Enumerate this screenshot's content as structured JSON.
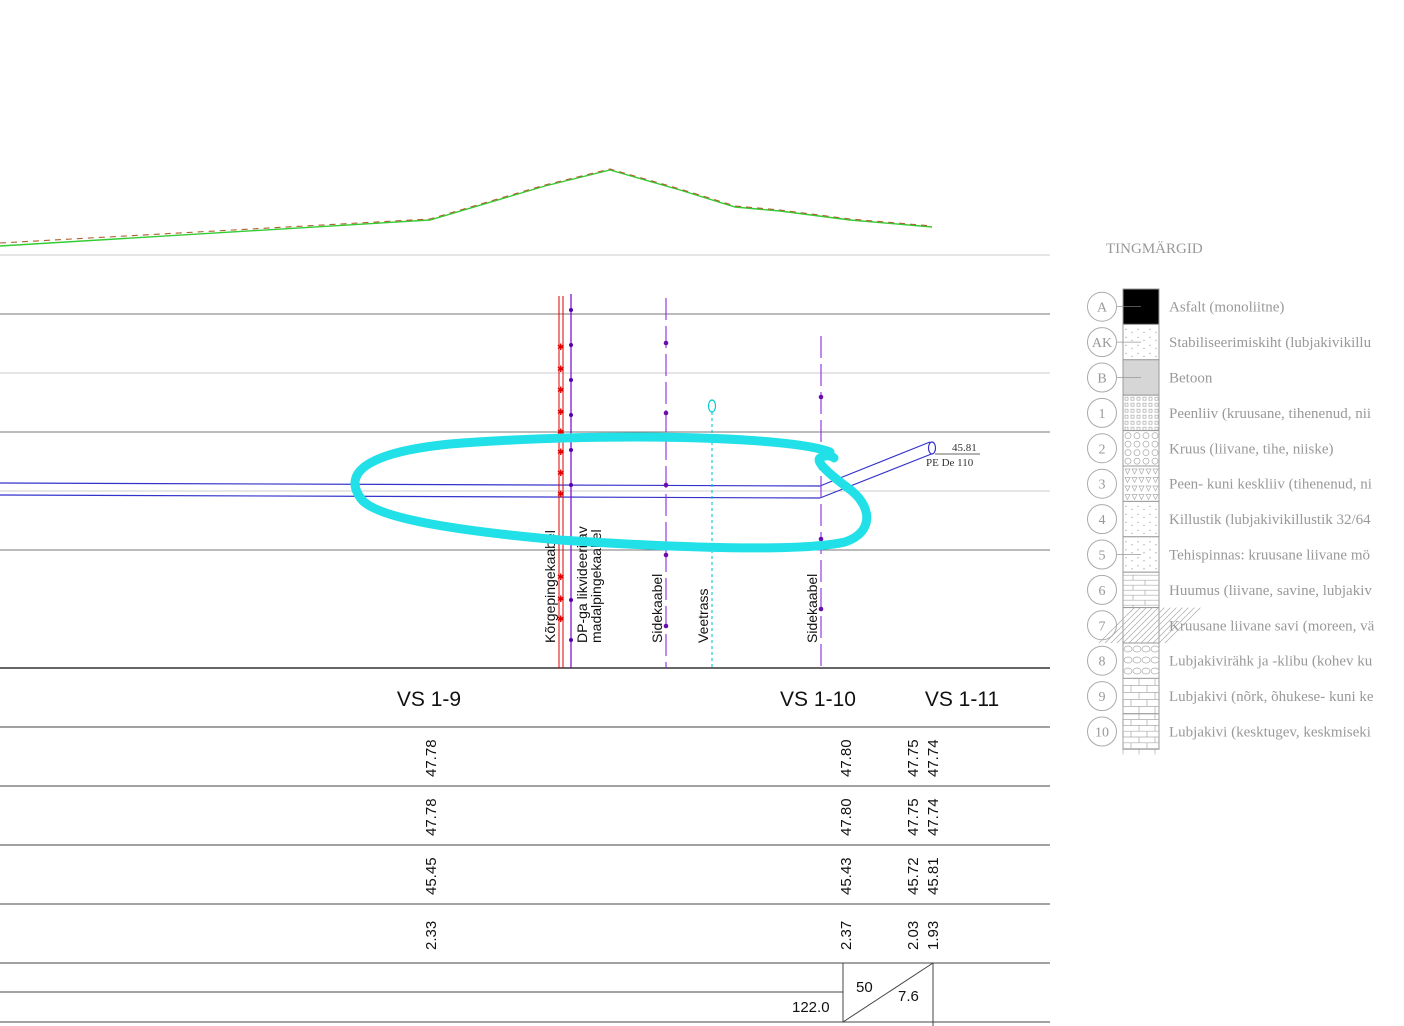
{
  "legend": {
    "title": "TINGMÄRGID",
    "items": [
      {
        "code": "A",
        "label": "Asfalt (monoliitne)",
        "pattern": "solid-black"
      },
      {
        "code": "AK",
        "label": "Stabiliseerimiskiht (lubjakivikillu",
        "pattern": "dots-fine"
      },
      {
        "code": "B",
        "label": "Betoon",
        "pattern": "solid-grey"
      },
      {
        "code": "1",
        "label": "Peenliiv (kruusane, tihenenud, nii",
        "pattern": "small-squares"
      },
      {
        "code": "2",
        "label": "Kruus (liivane, tihe, niiske)",
        "pattern": "circles"
      },
      {
        "code": "3",
        "label": "Peen- kuni keskliiv (tihenenud, ni",
        "pattern": "triangles"
      },
      {
        "code": "4",
        "label": "Killustik (lubjakivikillustik 32/64",
        "pattern": "scatter"
      },
      {
        "code": "5",
        "label": "Tehispinnas: kruusane liivane mö",
        "pattern": "mixed"
      },
      {
        "code": "6",
        "label": "Huumus (liivane, savine, lubjakiv",
        "pattern": "hatch-h"
      },
      {
        "code": "7",
        "label": "Kruusane liivane savi (moreen, vä",
        "pattern": "hatch-diag"
      },
      {
        "code": "8",
        "label": "Lubjakivirähk ja -klibu (kohev ku",
        "pattern": "rubble"
      },
      {
        "code": "9",
        "label": "Lubjakivi (nõrk, õhukese- kuni ke",
        "pattern": "bricks"
      },
      {
        "code": "10",
        "label": "Lubjakivi (kesktugev, keskmiseki",
        "pattern": "bricks-dense"
      }
    ]
  },
  "pipe": {
    "label_value": "45.81",
    "label_name": "PE De 110",
    "color": "#3333cc"
  },
  "utilities": [
    {
      "id": "korgepinge",
      "label": "Kõrgepingekaabel",
      "color": "#e00000"
    },
    {
      "id": "dp",
      "label": "DP-ga likvideeritav",
      "color": "#7a00cc"
    },
    {
      "id": "madalpinge",
      "label": "madalpingekaabel",
      "color": "#7a00cc"
    },
    {
      "id": "side1",
      "label": "Sidekaabel",
      "color": "#8a2be2"
    },
    {
      "id": "veetrass",
      "label": "Veetrass",
      "color": "#00cccc"
    },
    {
      "id": "side2",
      "label": "Sidekaabel",
      "color": "#8a2be2"
    }
  ],
  "stations": [
    {
      "name": "VS 1-9",
      "row1": [
        "47.78"
      ],
      "row2": [
        "47.78"
      ],
      "row3": [
        "45.45"
      ],
      "row4": [
        "2.33"
      ]
    },
    {
      "name": "VS 1-10",
      "row1": [
        "47.80"
      ],
      "row2": [
        "47.80"
      ],
      "row3": [
        "45.43"
      ],
      "row4": [
        "2.37"
      ]
    },
    {
      "name": "VS 1-11",
      "row1": [
        "47.75",
        "47.74"
      ],
      "row2": [
        "47.75",
        "47.74"
      ],
      "row3": [
        "45.72",
        "45.81"
      ],
      "row4": [
        "2.03",
        "1.93"
      ]
    }
  ],
  "bottom_row": {
    "length": "122.0",
    "diameter": "50",
    "slope": "7.6"
  },
  "colors": {
    "highlight": "#22e0e8",
    "ground_green": "#33cc33",
    "ground_red": "#cc3333",
    "grid_line": "#555555",
    "legend_text": "#999999"
  }
}
